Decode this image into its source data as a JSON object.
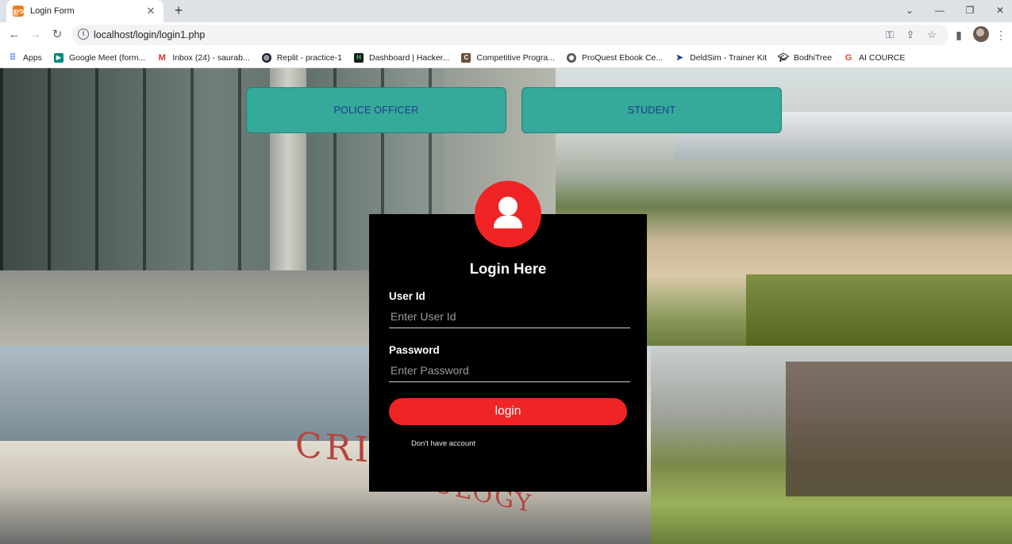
{
  "browser": {
    "tab": {
      "title": "Login Form",
      "favicon_icon": "xampp-icon"
    },
    "new_tab_icon": "+",
    "window_controls": {
      "minimize": "—",
      "restore": "❐",
      "close": "✕",
      "tab_search": "⌄"
    },
    "address": {
      "url": "localhost/login/login1.php"
    },
    "bookmarks": [
      {
        "label": "Apps",
        "icon": "apps-grid-icon"
      },
      {
        "label": "Google Meet (form...",
        "icon": "google-meet-icon"
      },
      {
        "label": "Inbox (24) - saurab...",
        "icon": "gmail-icon"
      },
      {
        "label": "Replit - practice-1",
        "icon": "replit-icon"
      },
      {
        "label": "Dashboard | Hacker...",
        "icon": "hackerearth-icon"
      },
      {
        "label": "Competitive Progra...",
        "icon": "codechef-icon"
      },
      {
        "label": "ProQuest Ebook Ce...",
        "icon": "proquest-icon"
      },
      {
        "label": "DeldSim - Trainer Kit",
        "icon": "deldsim-icon"
      },
      {
        "label": "BodhiTree",
        "icon": "bodhitree-icon"
      },
      {
        "label": "AI COURCE",
        "icon": "google-icon"
      }
    ]
  },
  "page": {
    "roles": {
      "police": "POLICE OFFICER",
      "student": "STUDENT"
    },
    "login": {
      "title": "Login Here",
      "user_label": "User Id",
      "user_placeholder": "Enter User Id",
      "password_label": "Password",
      "password_placeholder": "Enter Password",
      "submit_label": "login",
      "signup_text": "Don't have account"
    },
    "background_text": {
      "crim": "CRIM",
      "ology": "OLOGY"
    },
    "colors": {
      "role_button": "#35a99a",
      "accent_red": "#f02424",
      "card": "#000000"
    }
  }
}
